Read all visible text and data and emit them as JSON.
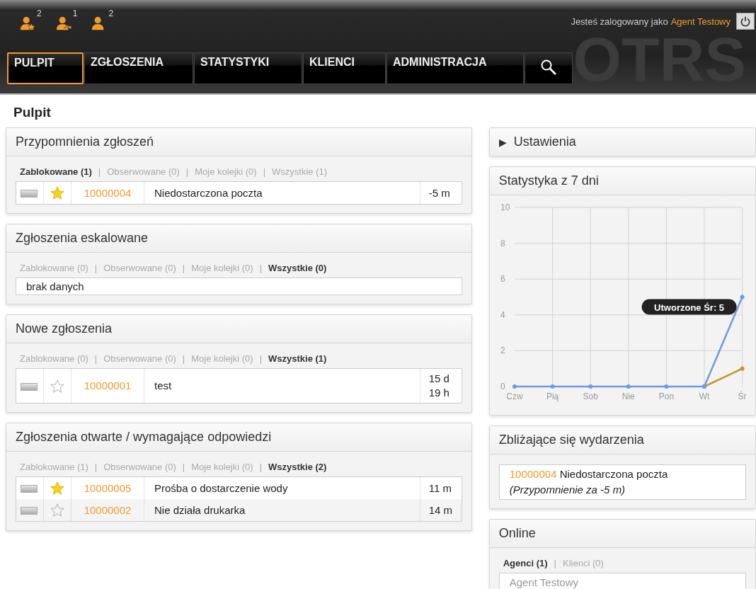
{
  "header": {
    "logo": "OTRS",
    "toolbar": [
      {
        "kind": "locked",
        "count": "2"
      },
      {
        "kind": "watched",
        "count": "1"
      },
      {
        "kind": "user",
        "count": "2"
      }
    ],
    "login_text": "Jesteś zalogowany jako",
    "user": "Agent Testowy"
  },
  "nav": [
    {
      "label": "PULPIT",
      "selected": true
    },
    {
      "label": "ZGŁOSZENIA",
      "selected": false
    },
    {
      "label": "STATYSTYKI",
      "selected": false
    },
    {
      "label": "KLIENCI",
      "selected": false
    },
    {
      "label": "ADMINISTRACJA",
      "selected": false
    },
    {
      "kind": "search",
      "selected": false
    }
  ],
  "page_title": "Pulpit",
  "widgets": [
    {
      "title": "Przypomnienia zgłoszeń",
      "filters": [
        {
          "label": "Zablokowane (1)",
          "selected": true
        },
        {
          "separator": "|",
          "label": "Obserwowane (0)",
          "selected": false
        },
        {
          "separator": "|",
          "label": "Moje kolejki (0)",
          "selected": false
        },
        {
          "separator": "|",
          "label": "Wszystkie (1)",
          "selected": false
        }
      ],
      "rows": [
        {
          "starred": true,
          "ticket": "10000004",
          "title": "Niedostarczona poczta",
          "age": "-5 m"
        }
      ]
    },
    {
      "title": "Zgłoszenia eskalowane",
      "filters": [
        {
          "label": "Zablokowane (0)",
          "selected": false
        },
        {
          "separator": "|",
          "label": "Obserwowane (0)",
          "selected": false
        },
        {
          "separator": "|",
          "label": "Moje kolejki (0)",
          "selected": false
        },
        {
          "separator": "|",
          "label": "Wszystkie (0)",
          "selected": true
        }
      ],
      "empty_text": "brak danych"
    },
    {
      "title": "Nowe zgłoszenia",
      "filters": [
        {
          "label": "Zablokowane (0)",
          "selected": false
        },
        {
          "separator": "|",
          "label": "Obserwowane (0)",
          "selected": false
        },
        {
          "separator": "|",
          "label": "Moje kolejki (0)",
          "selected": false
        },
        {
          "separator": "|",
          "label": "Wszystkie (1)",
          "selected": true
        }
      ],
      "rows": [
        {
          "starred": false,
          "ticket": "10000001",
          "title": "test",
          "age": "15 d 19 h"
        }
      ]
    },
    {
      "title": "Zgłoszenia otwarte / wymagające odpowiedzi",
      "filters": [
        {
          "label": "Zablokowane (1)",
          "selected": false
        },
        {
          "separator": "|",
          "label": "Obserwowane (0)",
          "selected": false
        },
        {
          "separator": "|",
          "label": "Moje kolejki (0)",
          "selected": false
        },
        {
          "separator": "|",
          "label": "Wszystkie (2)",
          "selected": true
        }
      ],
      "rows": [
        {
          "starred": true,
          "ticket": "10000005",
          "title": "Prośba o dostarczenie wody",
          "age": "11 m"
        },
        {
          "starred": false,
          "ticket": "10000002",
          "title": "Nie działa drukarka",
          "age": "14 m"
        }
      ]
    }
  ],
  "settings": {
    "icon": "▶",
    "label": "Ustawienia"
  },
  "stats": {
    "title": "Statystyka z 7 dni",
    "chart_data": {
      "type": "line",
      "categories": [
        "Czw",
        "Pią",
        "Sob",
        "Nie",
        "Pon",
        "Wt",
        "Śr"
      ],
      "series": [
        {
          "name": "Utworzone",
          "color": "#6f9ae0",
          "marker": true,
          "values": [
            0,
            0,
            0,
            0,
            0,
            0,
            5
          ]
        },
        {
          "color": "#c8922a",
          "marker": true,
          "values": [
            null,
            null,
            null,
            null,
            null,
            0,
            1
          ]
        }
      ],
      "ylim": [
        0,
        10
      ],
      "yticks": [
        0,
        2,
        4,
        6,
        8,
        10
      ],
      "grid": true,
      "annotations": [
        {
          "text": "Śr: 5"
        }
      ]
    }
  },
  "events": {
    "title": "Zbliżające się wydarzenia",
    "items": [
      {
        "ticket": "10000004",
        "title": "Niedostarczona poczta",
        "note": "(Przypomnienie za -5 m)"
      }
    ]
  },
  "online": {
    "title": "Online",
    "filters": [
      {
        "label": "Agenci (1)",
        "selected": true
      },
      {
        "separator": "|",
        "label": "Klienci (0)",
        "selected": false
      }
    ],
    "users": [
      "Agent Testowy"
    ]
  }
}
